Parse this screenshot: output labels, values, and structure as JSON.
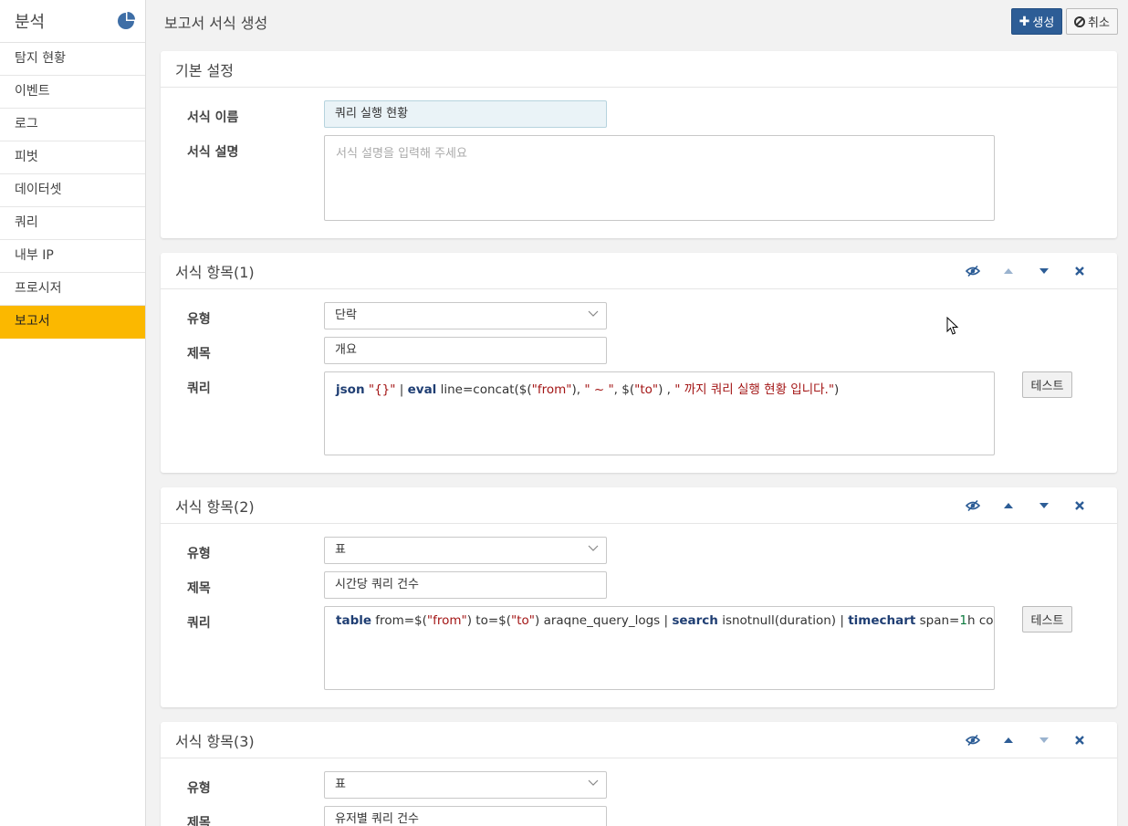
{
  "sidebar": {
    "title": "분석",
    "items": [
      {
        "label": "탐지 현황"
      },
      {
        "label": "이벤트"
      },
      {
        "label": "로그"
      },
      {
        "label": "피벗"
      },
      {
        "label": "데이터셋"
      },
      {
        "label": "쿼리"
      },
      {
        "label": "내부 IP"
      },
      {
        "label": "프로시저"
      },
      {
        "label": "보고서",
        "active": true
      }
    ]
  },
  "header": {
    "title": "보고서 서식 생성",
    "create_label": "생성",
    "cancel_label": "취소"
  },
  "basic": {
    "title": "기본 설정",
    "name_label": "서식 이름",
    "name_value": "쿼리 실행 현황",
    "desc_label": "서식 설명",
    "desc_placeholder": "서식 설명을 입력해 주세요"
  },
  "items": [
    {
      "title": "서식 항목(1)",
      "type_label": "유형",
      "type_value": "단락",
      "subject_label": "제목",
      "subject_value": "개요",
      "query_label": "쿼리",
      "query_tokens": [
        {
          "t": "json",
          "c": "kw"
        },
        {
          "t": " "
        },
        {
          "t": "\"{}\"",
          "c": "str"
        },
        {
          "t": " | "
        },
        {
          "t": "eval",
          "c": "kw"
        },
        {
          "t": " line=concat($("
        },
        {
          "t": "\"from\"",
          "c": "str"
        },
        {
          "t": "), "
        },
        {
          "t": "\" ~ \"",
          "c": "str"
        },
        {
          "t": ", $("
        },
        {
          "t": "\"to\"",
          "c": "str"
        },
        {
          "t": ") , "
        },
        {
          "t": "\" 까지 쿼리 실행 현황 입니다.\"",
          "c": "str"
        },
        {
          "t": ")"
        }
      ],
      "test_label": "테스트"
    },
    {
      "title": "서식 항목(2)",
      "type_label": "유형",
      "type_value": "표",
      "subject_label": "제목",
      "subject_value": "시간당 쿼리 건수",
      "query_label": "쿼리",
      "query_tokens": [
        {
          "t": "table",
          "c": "kw"
        },
        {
          "t": " from=$("
        },
        {
          "t": "\"from\"",
          "c": "str"
        },
        {
          "t": ") to=$("
        },
        {
          "t": "\"to\"",
          "c": "str"
        },
        {
          "t": ") araqne_query_logs | "
        },
        {
          "t": "search",
          "c": "kw"
        },
        {
          "t": " isnotnull(duration) | "
        },
        {
          "t": "timechart",
          "c": "kw"
        },
        {
          "t": " span="
        },
        {
          "t": "1",
          "c": "num"
        },
        {
          "t": "h count"
        }
      ],
      "test_label": "테스트"
    },
    {
      "title": "서식 항목(3)",
      "type_label": "유형",
      "type_value": "표",
      "subject_label": "제목",
      "subject_value": "유저별 쿼리 건수"
    }
  ],
  "icons": {
    "accent": "#2d5d96",
    "active_nav": "#fbb800",
    "tool_icons": [
      "eye-slash-icon",
      "caret-up-icon",
      "caret-down-icon",
      "close-icon"
    ]
  }
}
